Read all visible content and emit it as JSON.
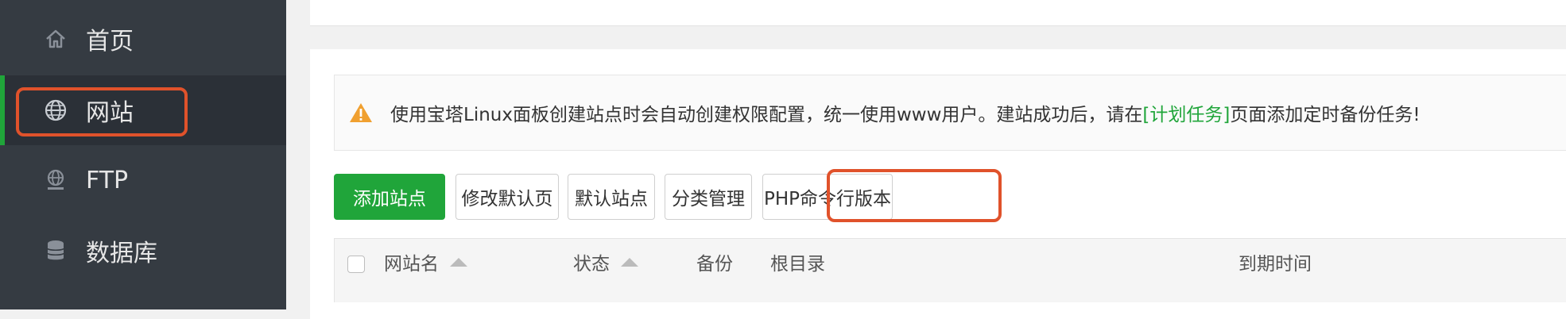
{
  "sidebar": {
    "items": [
      {
        "label": "首页",
        "icon": "home-icon"
      },
      {
        "label": "网站",
        "icon": "globe-icon",
        "active": true
      },
      {
        "label": "FTP",
        "icon": "ftp-icon"
      },
      {
        "label": "数据库",
        "icon": "database-icon"
      }
    ]
  },
  "notice": {
    "text_before": "使用宝塔Linux面板创建站点时会自动创建权限配置，统一使用www用户。建站成功后，请在",
    "link": "[计划任务]",
    "text_after": "页面添加定时备份任务!",
    "icon": "warning-icon"
  },
  "toolbar": {
    "add_site": "添加站点",
    "edit_default_page": "修改默认页",
    "default_site": "默认站点",
    "category_manage": "分类管理",
    "php_cli_version": "PHP命令行版本"
  },
  "table": {
    "columns": {
      "site_name": "网站名",
      "status": "状态",
      "backup": "备份",
      "root_dir": "根目录",
      "expire": "到期时间"
    }
  },
  "colors": {
    "sidebar_bg": "#353b42",
    "accent_green": "#20a53a",
    "highlight_red": "#e0522b",
    "warning_orange": "#f0a030"
  }
}
